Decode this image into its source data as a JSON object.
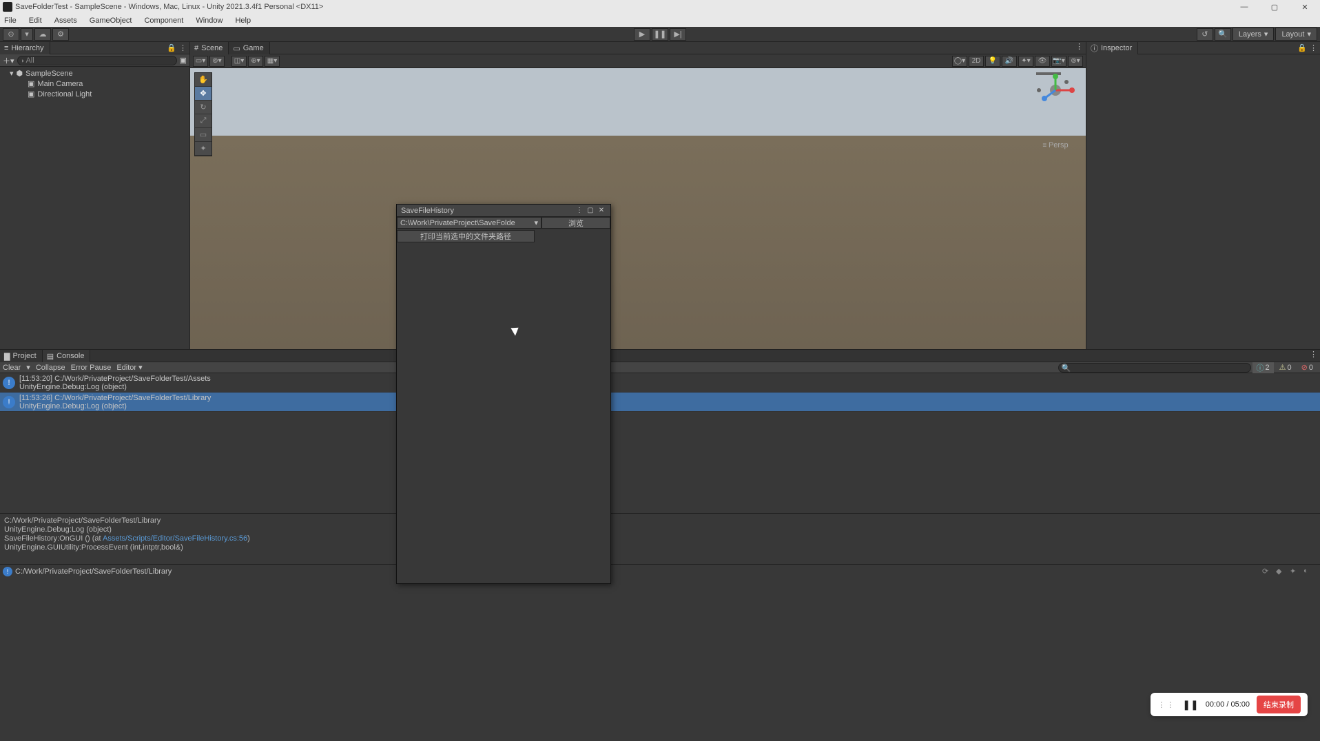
{
  "window": {
    "title": "SaveFolderTest - SampleScene - Windows, Mac, Linux - Unity 2021.3.4f1 Personal <DX11>"
  },
  "menu": [
    "File",
    "Edit",
    "Assets",
    "GameObject",
    "Component",
    "Window",
    "Help"
  ],
  "toolbar": {
    "layers": "Layers",
    "layout": "Layout"
  },
  "hierarchy": {
    "title": "Hierarchy",
    "search_placeholder": "All",
    "root": "SampleScene",
    "items": [
      "Main Camera",
      "Directional Light"
    ]
  },
  "scene": {
    "tab_scene": "Scene",
    "tab_game": "Game",
    "mode_2d": "2D",
    "persp": "Persp"
  },
  "inspector": {
    "title": "Inspector"
  },
  "floating": {
    "title": "SaveFileHistory",
    "path": "C:\\Work\\PrivateProject\\SaveFolde",
    "browse": "浏览",
    "print": "打印当前选中的文件夹路径"
  },
  "console": {
    "tab_project": "Project",
    "tab_console": "Console",
    "clear": "Clear",
    "collapse": "Collapse",
    "error_pause": "Error Pause",
    "editor": "Editor",
    "badges": {
      "info": "2",
      "warn": "0",
      "error": "0"
    },
    "entries": [
      {
        "line1": "[11:53:20] C:/Work/PrivateProject/SaveFolderTest/Assets",
        "line2": "UnityEngine.Debug:Log (object)"
      },
      {
        "line1": "[11:53:26] C:/Work/PrivateProject/SaveFolderTest/Library",
        "line2": "UnityEngine.Debug:Log (object)"
      }
    ],
    "details": {
      "l1": "C:/Work/PrivateProject/SaveFolderTest/Library",
      "l2": "UnityEngine.Debug:Log (object)",
      "l3_pre": "SaveFileHistory:OnGUI () (at ",
      "l3_link": "Assets/Scripts/Editor/SaveFileHistory.cs:56",
      "l3_post": ")",
      "l4": "UnityEngine.GUIUtility:ProcessEvent (int,intptr,bool&)"
    }
  },
  "status": {
    "text": "C:/Work/PrivateProject/SaveFolderTest/Library"
  },
  "recorder": {
    "time": "00:00 / 05:00",
    "stop": "结束录制"
  }
}
